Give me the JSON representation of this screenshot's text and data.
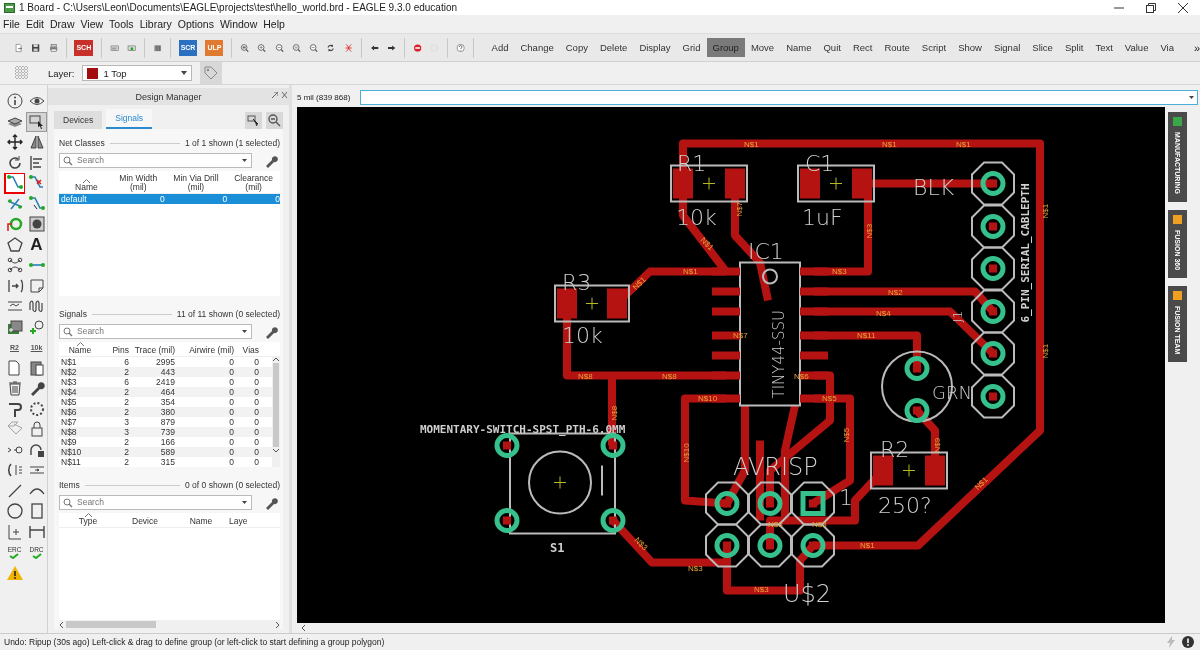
{
  "window": {
    "title": "1 Board - C:\\Users\\Leon\\Documents\\EAGLE\\projects\\test\\hello_world.brd - EAGLE 9.3.0 education"
  },
  "menu": [
    "File",
    "Edit",
    "Draw",
    "View",
    "Tools",
    "Library",
    "Options",
    "Window",
    "Help"
  ],
  "toolbar": [
    {
      "kind": "new",
      "disabled": false
    },
    {
      "kind": "save",
      "disabled": false
    },
    {
      "kind": "print",
      "disabled": false
    },
    {
      "kind": "separator"
    },
    {
      "kind": "badge",
      "label": "SCH",
      "color": "#c8302a",
      "disabled": false
    },
    {
      "kind": "separator"
    },
    {
      "kind": "board",
      "disabled": false
    },
    {
      "kind": "board-green",
      "disabled": false
    },
    {
      "kind": "separator"
    },
    {
      "kind": "cam",
      "disabled": false
    },
    {
      "kind": "separator"
    },
    {
      "kind": "badge",
      "label": "SCR",
      "color": "#2a6fc0",
      "disabled": false
    },
    {
      "kind": "badge",
      "label": "ULP",
      "color": "#e07a30",
      "disabled": false
    },
    {
      "kind": "separator"
    },
    {
      "kind": "zoom-fit",
      "disabled": false
    },
    {
      "kind": "zoom-in",
      "disabled": false
    },
    {
      "kind": "zoom-out",
      "disabled": false
    },
    {
      "kind": "zoom-select",
      "disabled": false
    },
    {
      "kind": "zoom-prev",
      "disabled": false
    },
    {
      "kind": "redraw",
      "disabled": false
    },
    {
      "kind": "crossing",
      "disabled": false
    },
    {
      "kind": "separator"
    },
    {
      "kind": "undo",
      "disabled": false
    },
    {
      "kind": "redo",
      "disabled": false
    },
    {
      "kind": "separator"
    },
    {
      "kind": "stop",
      "disabled": false
    },
    {
      "kind": "go",
      "disabled": true
    },
    {
      "kind": "separator"
    },
    {
      "kind": "help",
      "disabled": false
    }
  ],
  "commands": [
    {
      "label": "Add",
      "selected": false
    },
    {
      "label": "Change",
      "selected": false
    },
    {
      "label": "Copy",
      "selected": false
    },
    {
      "label": "Delete",
      "selected": false
    },
    {
      "label": "Display",
      "selected": false
    },
    {
      "label": "Grid",
      "selected": false
    },
    {
      "label": "Group",
      "selected": true
    },
    {
      "label": "Move",
      "selected": false
    },
    {
      "label": "Name",
      "selected": false
    },
    {
      "label": "Quit",
      "selected": false
    },
    {
      "label": "Rect",
      "selected": false
    },
    {
      "label": "Route",
      "selected": false
    },
    {
      "label": "Script",
      "selected": false
    },
    {
      "label": "Show",
      "selected": false
    },
    {
      "label": "Signal",
      "selected": false
    },
    {
      "label": "Slice",
      "selected": false
    },
    {
      "label": "Split",
      "selected": false
    },
    {
      "label": "Text",
      "selected": false
    },
    {
      "label": "Value",
      "selected": false
    },
    {
      "label": "Via",
      "selected": false
    }
  ],
  "commands_more": "»",
  "layer_bar": {
    "label": "Layer:",
    "layer": "1 Top",
    "color": "#a30d0d"
  },
  "tools": [
    {
      "kind": "info",
      "selected": false,
      "highlighted": false,
      "disabled": false
    },
    {
      "kind": "eye",
      "selected": false,
      "highlighted": false,
      "disabled": false
    },
    {
      "kind": "layers",
      "selected": false,
      "highlighted": false,
      "disabled": false
    },
    {
      "kind": "pointer",
      "selected": true,
      "highlighted": false,
      "disabled": false
    },
    {
      "kind": "move",
      "selected": false,
      "highlighted": false,
      "disabled": false
    },
    {
      "kind": "mirror",
      "selected": false,
      "highlighted": false,
      "disabled": false
    },
    {
      "kind": "rotate",
      "selected": false,
      "highlighted": false,
      "disabled": false
    },
    {
      "kind": "align",
      "selected": false,
      "highlighted": false,
      "disabled": false
    },
    {
      "kind": "route",
      "selected": false,
      "highlighted": true,
      "disabled": false
    },
    {
      "kind": "ripup",
      "selected": false,
      "highlighted": false,
      "disabled": false
    },
    {
      "kind": "split",
      "selected": false,
      "highlighted": false,
      "disabled": false
    },
    {
      "kind": "optimize",
      "selected": false,
      "highlighted": false,
      "disabled": false
    },
    {
      "kind": "via",
      "selected": false,
      "highlighted": false,
      "disabled": false
    },
    {
      "kind": "hole",
      "selected": false,
      "highlighted": false,
      "disabled": false
    },
    {
      "kind": "polygon",
      "selected": false,
      "highlighted": false,
      "disabled": false
    },
    {
      "kind": "letter",
      "label": "A",
      "selected": false,
      "highlighted": false,
      "disabled": false
    },
    {
      "kind": "ratsnest",
      "selected": false,
      "highlighted": false,
      "disabled": false
    },
    {
      "kind": "connect",
      "selected": false,
      "highlighted": false,
      "disabled": false
    },
    {
      "kind": "pinswap",
      "selected": false,
      "highlighted": false,
      "disabled": false
    },
    {
      "kind": "note",
      "selected": false,
      "highlighted": false,
      "disabled": false
    },
    {
      "kind": "meander",
      "selected": false,
      "highlighted": false,
      "disabled": false
    },
    {
      "kind": "wave",
      "selected": false,
      "highlighted": false,
      "disabled": false
    },
    {
      "kind": "stack",
      "selected": false,
      "highlighted": false,
      "disabled": false
    },
    {
      "kind": "add",
      "selected": false,
      "highlighted": false,
      "disabled": false
    },
    {
      "kind": "tag-text",
      "label": "R2",
      "selected": false,
      "highlighted": false,
      "disabled": false
    },
    {
      "kind": "tag-text",
      "label": "10k",
      "selected": false,
      "highlighted": false,
      "disabled": false
    },
    {
      "kind": "copy",
      "selected": false,
      "highlighted": false,
      "disabled": false
    },
    {
      "kind": "paste",
      "selected": false,
      "highlighted": false,
      "disabled": false
    },
    {
      "kind": "delete",
      "selected": false,
      "highlighted": false,
      "disabled": false
    },
    {
      "kind": "wrench",
      "selected": false,
      "highlighted": false,
      "disabled": false
    },
    {
      "kind": "hook",
      "selected": false,
      "highlighted": false,
      "disabled": false
    },
    {
      "kind": "dotted-circle",
      "selected": false,
      "highlighted": false,
      "disabled": false
    },
    {
      "kind": "tag",
      "selected": false,
      "highlighted": false,
      "disabled": true
    },
    {
      "kind": "lock",
      "selected": false,
      "highlighted": false,
      "disabled": false
    },
    {
      "kind": "attach",
      "selected": false,
      "highlighted": false,
      "disabled": false
    },
    {
      "kind": "gateway",
      "selected": false,
      "highlighted": false,
      "disabled": false
    },
    {
      "kind": "bracket",
      "selected": false,
      "highlighted": false,
      "disabled": false
    },
    {
      "kind": "merge",
      "selected": false,
      "highlighted": false,
      "disabled": false
    },
    {
      "kind": "line",
      "selected": false,
      "highlighted": false,
      "disabled": false
    },
    {
      "kind": "arc",
      "selected": false,
      "highlighted": false,
      "disabled": false
    },
    {
      "kind": "circle",
      "selected": false,
      "highlighted": false,
      "disabled": false
    },
    {
      "kind": "rect",
      "selected": false,
      "highlighted": false,
      "disabled": false
    },
    {
      "kind": "mark",
      "selected": false,
      "highlighted": false,
      "disabled": false
    },
    {
      "kind": "dimension",
      "selected": false,
      "highlighted": false,
      "disabled": false
    },
    {
      "kind": "check",
      "label": "ERC",
      "selected": false,
      "highlighted": false,
      "disabled": false
    },
    {
      "kind": "check",
      "label": "DRC",
      "selected": false,
      "highlighted": false,
      "disabled": false
    },
    {
      "kind": "warning",
      "selected": false,
      "highlighted": false,
      "disabled": false
    }
  ],
  "design_manager": {
    "title": "Design Manager",
    "tabs": [
      {
        "label": "Devices",
        "selected": false
      },
      {
        "label": "Signals",
        "selected": true
      }
    ],
    "net_classes": {
      "title": "Net Classes",
      "count": "1 of 1 shown (1 selected)",
      "search": {
        "placeholder": "Search"
      },
      "columns": [
        {
          "label": "Name"
        },
        {
          "label": "Min Width",
          "unit": "(mil)"
        },
        {
          "label": "Min Via Drill",
          "unit": "(mil)"
        },
        {
          "label": "Clearance",
          "unit": "(mil)"
        }
      ],
      "rows": [
        {
          "cells": [
            "default",
            "0",
            "0",
            "0"
          ],
          "selected": true
        }
      ]
    },
    "signals": {
      "title": "Signals",
      "count": "11 of 11 shown (0 selected)",
      "search": {
        "placeholder": "Search"
      },
      "columns": [
        "Name",
        "Pins",
        "Trace (mil)",
        "Airwire (mil)",
        "Vias"
      ],
      "rows": [
        {
          "cells": [
            "N$1",
            "6",
            "2995",
            "0",
            "0"
          ],
          "selected": false
        },
        {
          "cells": [
            "N$2",
            "2",
            "443",
            "0",
            "0"
          ],
          "selected": false
        },
        {
          "cells": [
            "N$3",
            "6",
            "2419",
            "0",
            "0"
          ],
          "selected": false
        },
        {
          "cells": [
            "N$4",
            "2",
            "464",
            "0",
            "0"
          ],
          "selected": false
        },
        {
          "cells": [
            "N$5",
            "2",
            "354",
            "0",
            "0"
          ],
          "selected": false
        },
        {
          "cells": [
            "N$6",
            "2",
            "380",
            "0",
            "0"
          ],
          "selected": false
        },
        {
          "cells": [
            "N$7",
            "3",
            "879",
            "0",
            "0"
          ],
          "selected": false
        },
        {
          "cells": [
            "N$8",
            "3",
            "739",
            "0",
            "0"
          ],
          "selected": false
        },
        {
          "cells": [
            "N$9",
            "2",
            "166",
            "0",
            "0"
          ],
          "selected": false
        },
        {
          "cells": [
            "N$10",
            "2",
            "589",
            "0",
            "0"
          ],
          "selected": false
        },
        {
          "cells": [
            "N$11",
            "2",
            "315",
            "0",
            "0"
          ],
          "selected": false
        }
      ]
    },
    "items": {
      "title": "Items",
      "count": "0 of 0 shown (0 selected)",
      "search": {
        "placeholder": "Search"
      },
      "columns": [
        "Type",
        "Device",
        "Name",
        "Laye"
      ]
    }
  },
  "board_view": {
    "coordinates": "5 mil (839 868)",
    "side_tabs": [
      {
        "label": "MANUFACTURING",
        "color": "#3aa84a"
      },
      {
        "label": "FUSION 360",
        "color": "#f0a020"
      },
      {
        "label": "FUSION TEAM",
        "color": "#f0a020"
      }
    ],
    "labels": [
      {
        "text": "R1"
      },
      {
        "text": "10k"
      },
      {
        "text": "C1"
      },
      {
        "text": "1uF"
      },
      {
        "text": "BLK"
      },
      {
        "text": "IC1"
      },
      {
        "text": "R3"
      },
      {
        "text": "10k"
      },
      {
        "text": "MOMENTARY-SWITCH-SPST_PTH-6.0MM"
      },
      {
        "text": "S1"
      },
      {
        "text": "GRN"
      },
      {
        "text": "R2"
      },
      {
        "text": "250?"
      },
      {
        "text": "AVRISP"
      },
      {
        "text": "1"
      },
      {
        "text": "U$2"
      },
      {
        "text": "6_PIN_SERIAL_CABLEPTH"
      },
      {
        "text": "J1"
      },
      {
        "text": "TINY44-SSU"
      }
    ],
    "net_labels": [
      "N$1",
      "N$1",
      "N$1",
      "N$7",
      "N$1",
      "N$3",
      "N$1",
      "N$1",
      "N$3",
      "N$1",
      "N$2",
      "N$4",
      "N$7",
      "N$11",
      "N$1",
      "N$8",
      "N$8",
      "N$6",
      "N$10",
      "N$5",
      "N$8",
      "N$5",
      "N$10",
      "N$9",
      "N$1",
      "N$3",
      "N$3",
      "N$3",
      "N$1",
      "N$3",
      "N$3"
    ]
  },
  "status_bar": {
    "message": "Undo: Ripup (30s ago) Left-click & drag to define group (or left-click to start defining a group polygon)"
  }
}
